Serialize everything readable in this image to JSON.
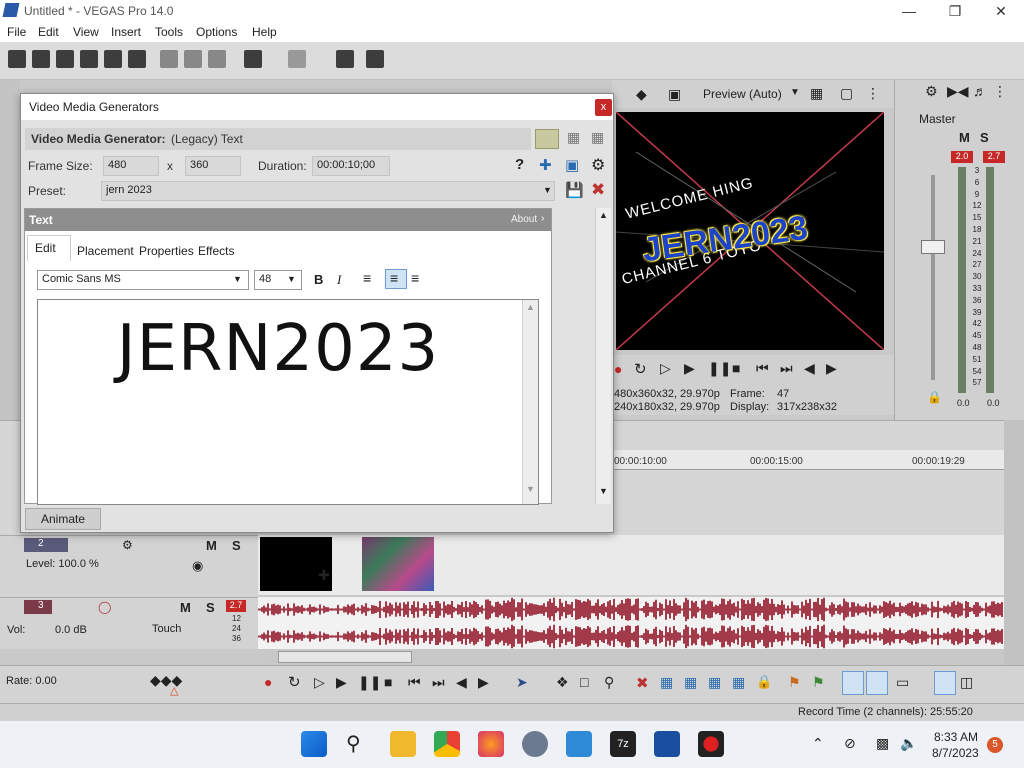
{
  "window": {
    "title": "Untitled * - VEGAS Pro 14.0"
  },
  "menu": [
    "File",
    "Edit",
    "View",
    "Insert",
    "Tools",
    "Options",
    "Help"
  ],
  "preview": {
    "mode_label": "Preview (Auto)",
    "overlay_lines": [
      "WELCOME HING",
      "CHANNEL 6 TOYO"
    ],
    "overlay_title": "JERN2023",
    "project_info": "480x360x32, 29.970p",
    "frame_label": "Frame:",
    "frame_value": "47",
    "preview_info": "240x180x32, 29.970p",
    "display_label": "Display:",
    "display_value": "317x238x32"
  },
  "master": {
    "label": "Master",
    "m": "M",
    "s": "S",
    "left_peak": "2.0",
    "right_peak": "2.7",
    "scale": [
      "3",
      "6",
      "9",
      "12",
      "15",
      "18",
      "21",
      "24",
      "27",
      "30",
      "33",
      "36",
      "39",
      "42",
      "45",
      "48",
      "51",
      "54",
      "57"
    ],
    "bottom_left": "0.0",
    "bottom_right": "0.0"
  },
  "dialog": {
    "title": "Video Media Generators",
    "close": "x",
    "generator_label": "Video Media Generator:",
    "generator_value": "(Legacy) Text",
    "frame_size_label": "Frame Size:",
    "width": "480",
    "x": "x",
    "height": "360",
    "duration_label": "Duration:",
    "duration": "00:00:10;00",
    "preset_label": "Preset:",
    "preset": "jern 2023",
    "panel_title": "Text",
    "about": "About",
    "tabs": [
      "Edit",
      "Placement",
      "Properties",
      "Effects"
    ],
    "font": "Comic Sans MS",
    "size": "48",
    "bold": "B",
    "italic": "I",
    "text": "JERN2023",
    "animate": "Animate"
  },
  "timeline": {
    "ruler": [
      "00:00:10:00",
      "00:00:15:00",
      "00:00:19:29"
    ],
    "video_track": {
      "number": "2",
      "level_label": "Level: 100.0 %"
    },
    "audio_track": {
      "number": "3",
      "peak": "2.7",
      "vol": "Vol:",
      "vol_value": "0.0 dB",
      "touch": "Touch",
      "m": "M",
      "s": "S",
      "meter": [
        "12",
        "24",
        "36"
      ]
    },
    "rate": "Rate: 0.00"
  },
  "status": {
    "record_time": "Record Time (2 channels): 25:55:20"
  },
  "taskbar": {
    "time": "8:33 AM",
    "date": "8/7/2023",
    "notif": "5"
  },
  "colors": {
    "accent_red": "#c62828",
    "waveform": "#a33a4a",
    "dialog_bg": "#e2e2e2",
    "toolbar": "#dcdcdc"
  }
}
